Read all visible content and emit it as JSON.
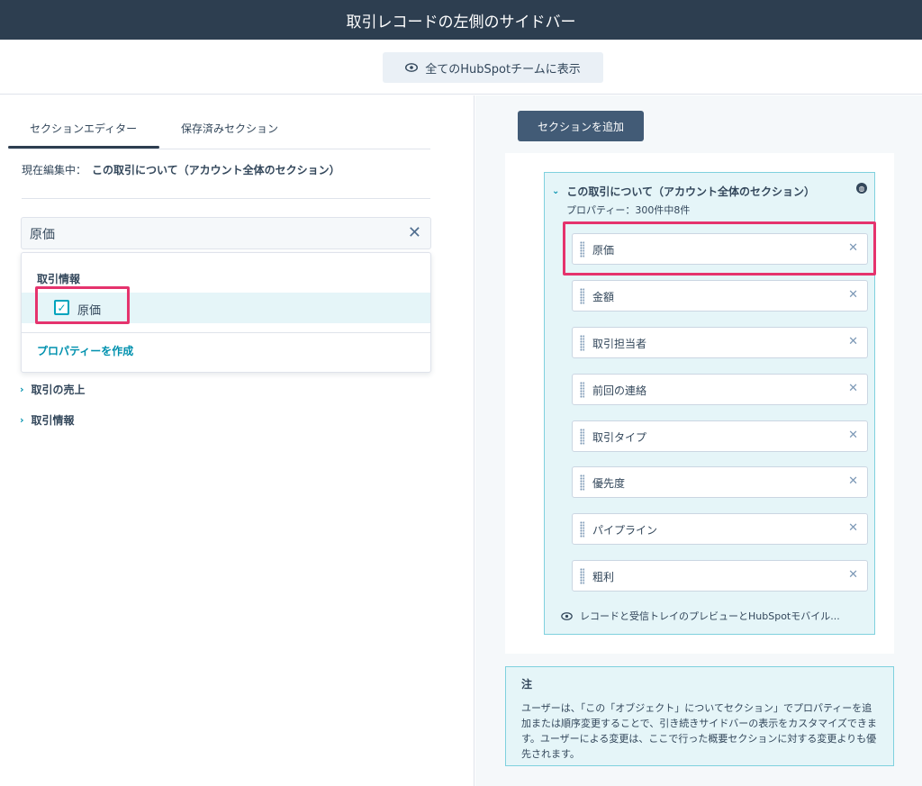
{
  "header": {
    "title": "取引レコードの左側のサイドバー"
  },
  "toolbar": {
    "show_all_label": "全てのHubSpotチームに表示"
  },
  "left": {
    "tabs": [
      "セクションエディター",
      "保存済みセクション"
    ],
    "editing_prefix": "現在編集中：",
    "editing_section": "この取引について（アカウント全体のセクション）",
    "search": {
      "value": "原価"
    },
    "dropdown": {
      "group": "取引情報",
      "item": "原価",
      "create_label": "プロパティーを作成"
    },
    "categories": [
      "取引の売上",
      "取引情報"
    ]
  },
  "right": {
    "add_section_label": "セクションを追加",
    "section": {
      "title": "この取引について（アカウント全体のセクション）",
      "count": "プロパティー：300件中8件",
      "properties": [
        "原価",
        "金額",
        "取引担当者",
        "前回の連絡",
        "取引タイプ",
        "優先度",
        "パイプライン",
        "粗利"
      ],
      "preview": "レコードと受信トレイのプレビューとHubSpotモバイル..."
    },
    "note": {
      "title": "注",
      "body": "ユーザーは、「この「オブジェクト」についてセクション」でプロパティーを追加または順序変更することで、引き続きサイドバーの表示をカスタマイズできます。ユーザーによる変更は、ここで行った概要セクションに対する変更よりも優先されます。"
    }
  },
  "colors": {
    "header_bg": "#2d3e50",
    "accent": "#00a4bd",
    "highlight": "#e5336d",
    "link": "#0091ae"
  }
}
